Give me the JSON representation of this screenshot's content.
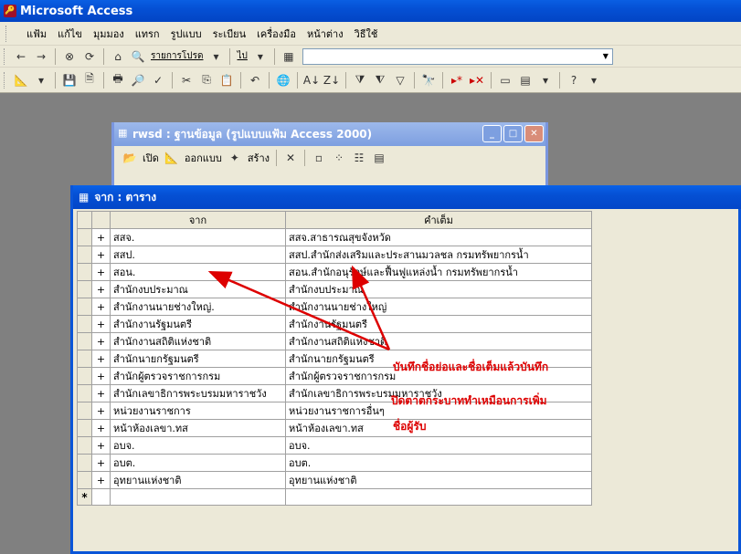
{
  "app": {
    "title": "Microsoft Access"
  },
  "menu": [
    "แฟ้ม",
    "แก้ไข",
    "มุมมอง",
    "แทรก",
    "รูปแบบ",
    "ระเบียน",
    "เครื่องมือ",
    "หน้าต่าง",
    "วิธีใช้"
  ],
  "toolbar1": {
    "records_label": "รายการโปรด",
    "go_label": "ไป"
  },
  "db_window": {
    "title": "rwsd : ฐานข้อมูล (รูปแบบแฟ้ม Access 2000)",
    "open_label": "เปิด",
    "design_label": "ออกแบบ",
    "new_label": "สร้าง"
  },
  "table_window": {
    "title": "จาก : ตาราง"
  },
  "table": {
    "columns": [
      "จาก",
      "คำเต็ม"
    ],
    "rows": [
      [
        "สสจ.",
        "สสจ.สาธารณสุขจังหวัด"
      ],
      [
        "สสป.",
        "สสป.สำนักส่งเสริมและประสานมวลชล กรมทรัพยากรน้ำ"
      ],
      [
        "สอน.",
        "สอน.สำนักอนุรักษ์และฟื้นฟูแหล่งน้ำ กรมทรัพยากรน้ำ"
      ],
      [
        "สำนักงบประมาณ",
        "สำนักงบประมาณ"
      ],
      [
        "สำนักงานนายช่างใหญ่.",
        "สำนักงานนายช่างใหญ่"
      ],
      [
        "สำนักงานรัฐมนตรี",
        "สำนักงานรัฐมนตรี"
      ],
      [
        "สำนักงานสถิติแห่งชาติ",
        "สำนักงานสถิติแห่งชาติ"
      ],
      [
        "สำนักนายกรัฐมนตรี",
        "สำนักนายกรัฐมนตรี"
      ],
      [
        "สำนักผู้ตรวจราชการกรม",
        "สำนักผู้ตรวจราชการกรม"
      ],
      [
        "สำนักเลขาธิการพระบรมมหาราชวัง",
        "สำนักเลขาธิการพระบรมมหาราชวัง"
      ],
      [
        "หน่วยงานราชการ",
        "หน่วยงานราชการอื่นๆ"
      ],
      [
        "หน้าห้องเลขา.ทส",
        "หน้าห้องเลขา.ทส"
      ],
      [
        "อบจ.",
        "อบจ."
      ],
      [
        "อบต.",
        "อบต."
      ],
      [
        "อุทยานแห่งชาติ",
        "อุทยานแห่งชาติ"
      ]
    ],
    "new_row_marker": "*"
  },
  "annotation": [
    "บันทึกชื่อย่อและชื่อเต็มแล้วบันทึก",
    "ปิดตาตกระบาททำเหมือนการเพิ่ม",
    "ชื่อผู้รับ"
  ],
  "colors": {
    "title_blue": "#0550d4",
    "annotation_red": "#dd0000"
  }
}
